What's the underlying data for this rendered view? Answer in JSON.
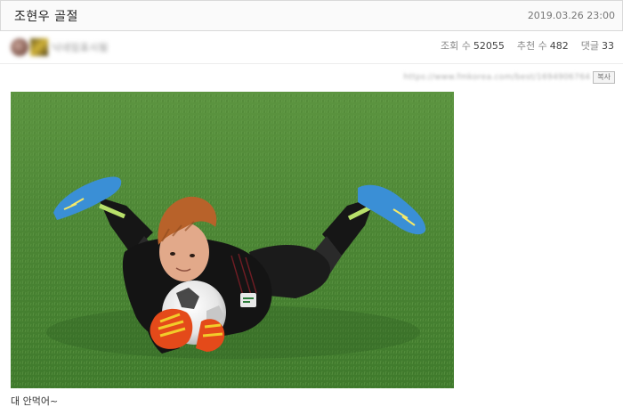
{
  "post": {
    "title": "조현우 골절",
    "date": "2019.03.26 23:00",
    "author": "",
    "caption": "대 안먹어~"
  },
  "stats": {
    "views_label": "조회 수",
    "views": "52055",
    "recommend_label": "추천 수",
    "recommend": "482",
    "comments_label": "댓글",
    "comments": "33"
  },
  "source": {
    "url": "https://www.fmkorea.com/best/1694906764",
    "copy_label": "복사"
  },
  "colors": {
    "grass": "#4f8a3a",
    "jersey": "#151515",
    "boots": "#3a8fd6"
  },
  "icons": {
    "avatar_primary": "profile-avatar",
    "avatar_level": "level-badge"
  }
}
